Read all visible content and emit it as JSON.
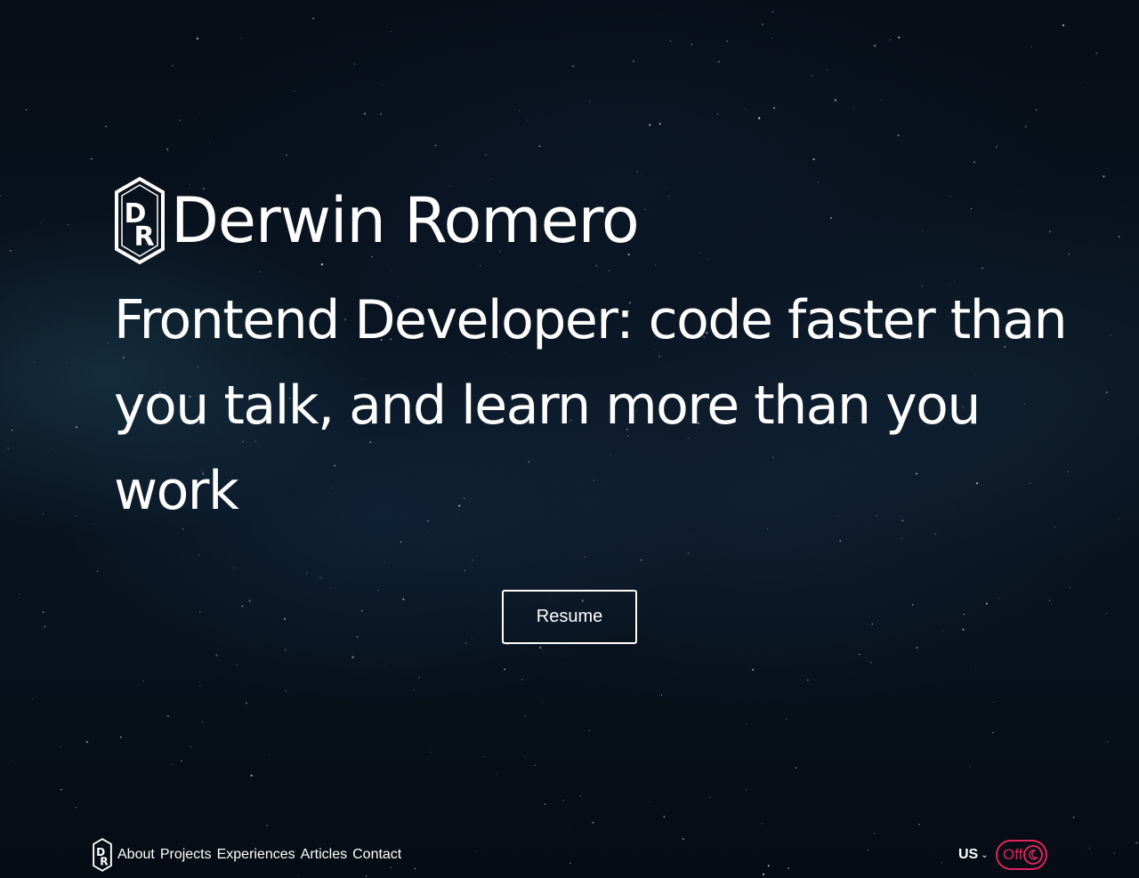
{
  "hero": {
    "logo_icon": "dr-hexagon-logo-icon",
    "name": "Derwin Romero",
    "tagline": "Frontend Developer: code faster than you talk, and learn more than you work"
  },
  "resume_button": {
    "label": "Resume"
  },
  "nav": {
    "logo_icon": "dr-hexagon-logo-icon",
    "links": [
      "About",
      "Projects",
      "Experiences",
      "Articles",
      "Contact"
    ]
  },
  "language_selector": {
    "value": "US",
    "icon": "chevron-down-icon"
  },
  "theme_toggle": {
    "label": "Off",
    "icon": "moon-icon",
    "color": "#e0245e"
  }
}
